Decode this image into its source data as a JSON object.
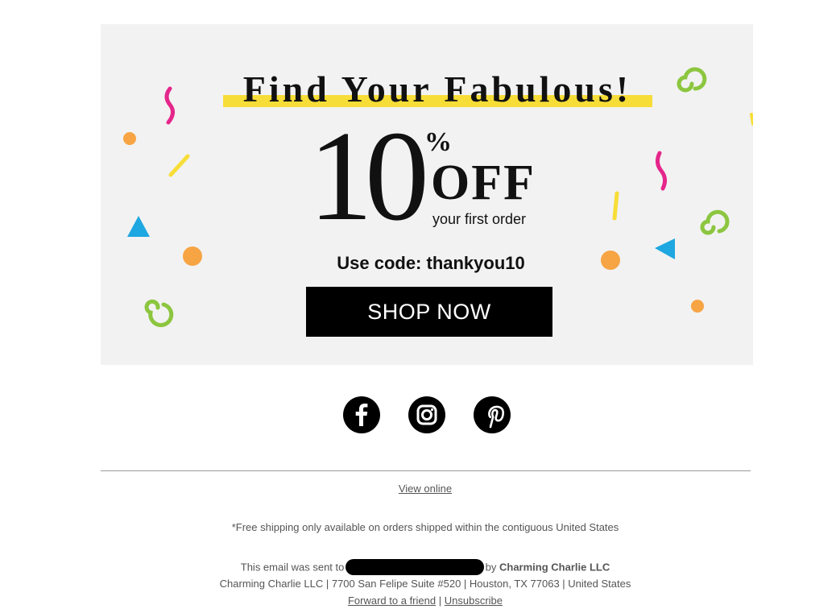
{
  "banner": {
    "headline": "Find Your Fabulous!",
    "discount_number": "10",
    "discount_percent": "%",
    "discount_off": "OFF",
    "discount_subtitle": "your first order",
    "code_text": "Use code: thankyou10",
    "shop_button": "SHOP NOW",
    "colors": {
      "background": "#f2f2f2",
      "highlight": "#f7dd37",
      "button": "#000000"
    }
  },
  "social": [
    {
      "name": "facebook-icon"
    },
    {
      "name": "instagram-icon"
    },
    {
      "name": "pinterest-icon"
    }
  ],
  "footer": {
    "view_online": "View online",
    "shipping_note": "*Free shipping only available on orders shipped within the contiguous United States",
    "sent_prefix": "This email was sent to",
    "sent_by": "by",
    "company": "Charming Charlie LLC",
    "address": "Charming Charlie LLC | 7700 San Felipe Suite #520 | Houston, TX 77063 | United States",
    "forward": "Forward to a friend",
    "separator": "|",
    "unsubscribe": "Unsubscribe"
  }
}
